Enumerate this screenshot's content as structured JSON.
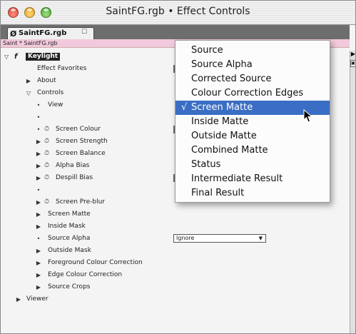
{
  "window": {
    "title": "SaintFG.rgb • Effect Controls"
  },
  "tab": {
    "label": "SaintFG.rgb"
  },
  "layer_path": "Saint * SaintFG.rgb",
  "effect": {
    "name": "Keylight",
    "fx": "f"
  },
  "rows": {
    "effect_favorites": "Effect Favorites",
    "about": "About",
    "controls": "Controls",
    "view": "View",
    "screen_colour": "Screen Colour",
    "screen_strength": "Screen Strength",
    "screen_balance": "Screen Balance",
    "alpha_bias": "Alpha Bias",
    "despill_bias": "Despill Bias",
    "screen_preblur": "Screen Pre-blur",
    "screen_matte": "Screen Matte",
    "inside_mask": "Inside Mask",
    "source_alpha": "Source Alpha",
    "outside_mask": "Outside Mask",
    "fg_colour_correction": "Foreground Colour Correction",
    "edge_colour_correction": "Edge Colour Correction",
    "source_crops": "Source Crops",
    "viewer": "Viewer"
  },
  "source_alpha_select": {
    "value": "Ignore"
  },
  "view_menu": {
    "selected_index": 4,
    "check": "√",
    "items": [
      "Source",
      "Source Alpha",
      "Corrected Source",
      "Colour Correction Edges",
      "Screen Matte",
      "Inside Matte",
      "Outside Matte",
      "Combined Matte",
      "Status",
      "Intermediate Result",
      "Final Result"
    ]
  },
  "icons": {
    "expanded": "▽",
    "collapsed": "▶",
    "bullet": "•",
    "stopwatch": "⏱"
  },
  "colors": {
    "menu_highlight": "#3a6ec4",
    "layer_bar": "#f2c9dc"
  }
}
